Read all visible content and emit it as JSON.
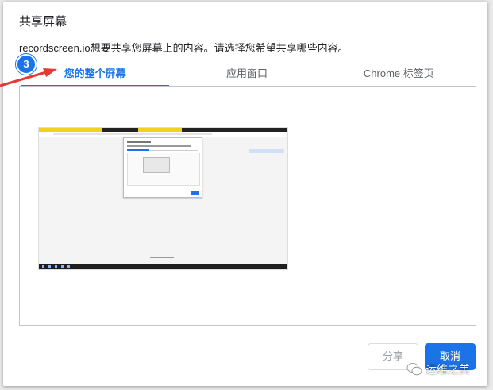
{
  "dialog": {
    "title": "共享屏幕",
    "subtitle": "recordscreen.io想要共享您屏幕上的内容。请选择您希望共享哪些内容。"
  },
  "tabs": [
    {
      "label": "您的整个屏幕",
      "active": true
    },
    {
      "label": "应用窗口",
      "active": false
    },
    {
      "label": "Chrome 标签页",
      "active": false
    }
  ],
  "annotation": {
    "step_number": "3",
    "arrow_color": "#e53935"
  },
  "buttons": {
    "share_label": "分享",
    "cancel_label": "取消"
  },
  "watermark": {
    "text": "运维之美",
    "icon": "wechat-icon"
  },
  "colors": {
    "accent": "#1a73e8"
  }
}
